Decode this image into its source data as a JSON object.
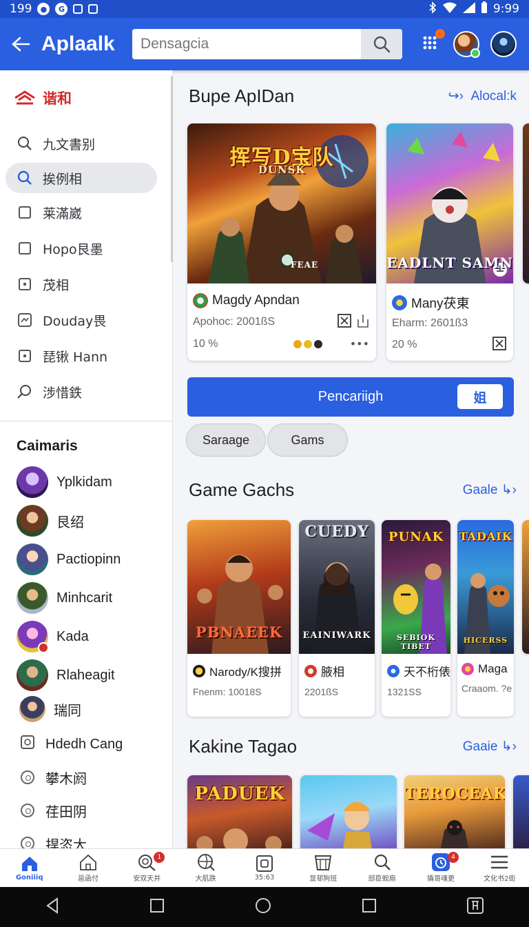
{
  "status_bar": {
    "left_text": "199",
    "time": "9:99"
  },
  "header": {
    "title": "Aplaalk",
    "search": {
      "value": "",
      "placeholder": "Densagcia"
    }
  },
  "sidebar": {
    "brand_label": "谐和",
    "nav_items": [
      {
        "label": "九文書别",
        "icon": "search-icon"
      },
      {
        "label": "挨例相",
        "icon": "search-icon",
        "active": true
      },
      {
        "label": "莱滿崴",
        "icon": "square-icon"
      },
      {
        "label": "Hopo艮墨",
        "icon": "square-icon"
      },
      {
        "label": "茂相",
        "icon": "square-dot-icon"
      },
      {
        "label": "Douday畏",
        "icon": "image-icon"
      },
      {
        "label": "琵锹 Hann",
        "icon": "square-dot-icon"
      },
      {
        "label": "涉惜鉄",
        "icon": "search-icon"
      }
    ],
    "categories_title": "Caimaris",
    "categories": [
      {
        "label": "Yplkidam"
      },
      {
        "label": "艮绍"
      },
      {
        "label": "Pactiopinn"
      },
      {
        "label": "Minhcarit"
      },
      {
        "label": "Kada",
        "badge": true
      },
      {
        "label": "Rlaheagit"
      },
      {
        "label": "瑞同"
      }
    ],
    "extra_items": [
      {
        "label": "Hdedh Cang"
      },
      {
        "label": "攀木阏"
      },
      {
        "label": "荏田阴"
      },
      {
        "label": "捍恣大"
      }
    ]
  },
  "sections": {
    "featured": {
      "title": "Bupe ApIDan",
      "link": "Alocal:k"
    },
    "games": {
      "title": "Game Gachs",
      "link": "Gaale"
    },
    "trending": {
      "title": "Kakine Tagao",
      "link": "Gaaie"
    }
  },
  "featured_cards": [
    {
      "art_title": "挥写D宝队",
      "art_sub": "DUNSK",
      "art_tag": "FEAE",
      "name": "Magdy Apndan",
      "meta": "Apohoc: 2001ßS",
      "rating": "10 %"
    },
    {
      "art_title": "EADLNT SAMN",
      "art_sub": "",
      "art_tag": "",
      "name": "Many茯東",
      "meta": "Eharm: 2601ß3",
      "rating": "20 %"
    }
  ],
  "cta": {
    "label": "Pencariigh",
    "badge": "姐"
  },
  "chips": [
    "Saraage",
    "Gams"
  ],
  "game_cards": [
    {
      "art_title": "PBNAEEK",
      "art_top": "",
      "name": "Narody/K搜拼",
      "meta": "Fnenm: 10018S"
    },
    {
      "art_title": "EAINIWARK",
      "art_top": "CUEDY",
      "name": "腋相",
      "meta": "2201ßS"
    },
    {
      "art_title": "SEBIOK TIBET",
      "art_top": "PUNAK",
      "name": "天不桁俵",
      "meta": "1321SS"
    },
    {
      "art_title": "HICERSS",
      "art_top": "TADAIK",
      "name": "Maga",
      "meta": "Craaom. ?e"
    }
  ],
  "trending_cards": [
    {
      "art_title": "PADUEK"
    },
    {
      "art_title": ""
    },
    {
      "art_title": "TEROCEAK"
    }
  ],
  "bottom_nav": [
    {
      "label": "Goniiiq",
      "icon": "home-icon",
      "active": true
    },
    {
      "label": "邕函付",
      "icon": "house-outline-icon"
    },
    {
      "label": "安双天并",
      "icon": "search-badge-icon",
      "badge": "1"
    },
    {
      "label": "大肌跌",
      "icon": "globe-search-icon"
    },
    {
      "label": "35:63",
      "icon": "camera-square-icon"
    },
    {
      "label": "显邨狗班",
      "icon": "basket-icon"
    },
    {
      "label": "邸臣蚬扇",
      "icon": "search-icon"
    },
    {
      "label": "撬哥魂更",
      "icon": "clock-badge-icon",
      "badge": "4"
    },
    {
      "label": "文化书2街",
      "icon": "menu-icon"
    }
  ],
  "colors": {
    "primary": "#2a5fe0",
    "accent_red": "#d42a2a",
    "surface": "#ffffff"
  }
}
